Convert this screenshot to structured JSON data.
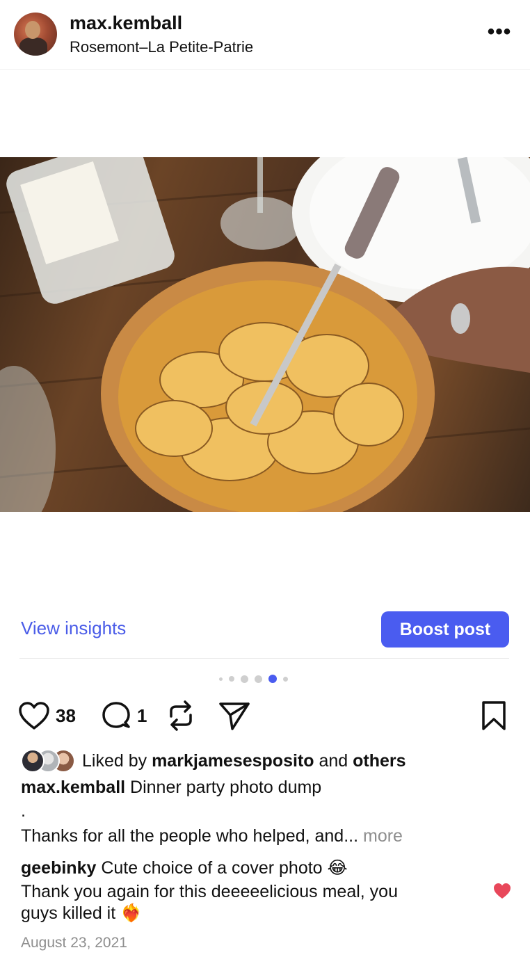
{
  "header": {
    "username": "max.kemball",
    "location": "Rosemont–La Petite-Patrie",
    "more_label": "•••"
  },
  "post": {
    "image_alt": "Sweet potato galette being cut on a wooden table",
    "insights_label": "View insights",
    "boost_label": "Boost post",
    "carousel": {
      "count": 6,
      "active_index": 4
    },
    "likes_count": "38",
    "comments_count": "1"
  },
  "likes": {
    "prefix": "Liked by",
    "user": "markjamesesposito",
    "middle": "and",
    "others": "others"
  },
  "caption": {
    "user": "max.kemball",
    "text": "Dinner party photo dump",
    "dot": ".",
    "line2": "Thanks for all the people who helped, and...",
    "more": "more"
  },
  "comment": {
    "user": "geebinky",
    "text": "Cute choice of a cover photo",
    "emoji1": "😂",
    "line2": "Thank you again for this deeeeelicious meal, you",
    "line3": "guys killed it",
    "emoji2": "❤️‍🔥"
  },
  "date": "August 23, 2021",
  "colors": {
    "accent": "#4a5cf0",
    "link": "#4a5ce8",
    "muted": "#8e8e8e",
    "heart": "#e8475a"
  }
}
